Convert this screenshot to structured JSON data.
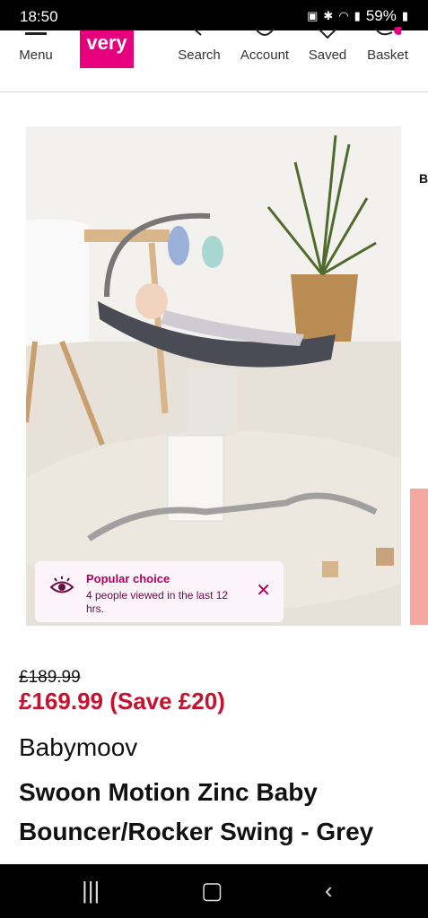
{
  "status": {
    "time": "18:50",
    "battery": "59%"
  },
  "header": {
    "menu_label": "Menu",
    "logo_text": "very",
    "search_label": "Search",
    "account_label": "Account",
    "saved_label": "Saved",
    "basket_label": "Basket",
    "brand_color": "#e6007e"
  },
  "popular": {
    "title": "Popular choice",
    "subtitle": "4 people viewed in the last 12 hrs.",
    "close_glyph": "✕"
  },
  "side_peek_letter": "B",
  "price": {
    "was": "£189.99",
    "now": "£169.99 (Save £20)",
    "sale_color": "#c4122f"
  },
  "product": {
    "brand": "Babymoov",
    "title": "Swoon Motion Zinc Baby Bouncer/Rocker Swing - Grey"
  }
}
